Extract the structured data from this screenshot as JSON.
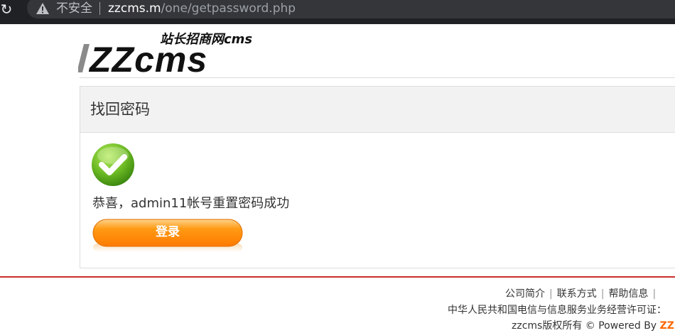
{
  "browser": {
    "security_label": "不安全",
    "url_host": "zzcms.m",
    "url_path": "/one/getpassword.php"
  },
  "logo": {
    "main": "ZZcms",
    "sub": "站长招商网cms"
  },
  "panel": {
    "title": "找回密码",
    "message": "恭喜，admin11帐号重置密码成功",
    "login_button": "登录"
  },
  "footer": {
    "links": [
      "公司简介",
      "联系方式",
      "帮助信息"
    ],
    "license": "中华人民共和国电信与信息服务业务经营许可证：",
    "copyright_prefix": "zzcms版权所有 © Powered By ",
    "copyright_brand": "ZZ"
  },
  "colors": {
    "accent_orange": "#ff8a00",
    "footer_rule": "#c9302c",
    "success_green": "#5aa51c"
  }
}
